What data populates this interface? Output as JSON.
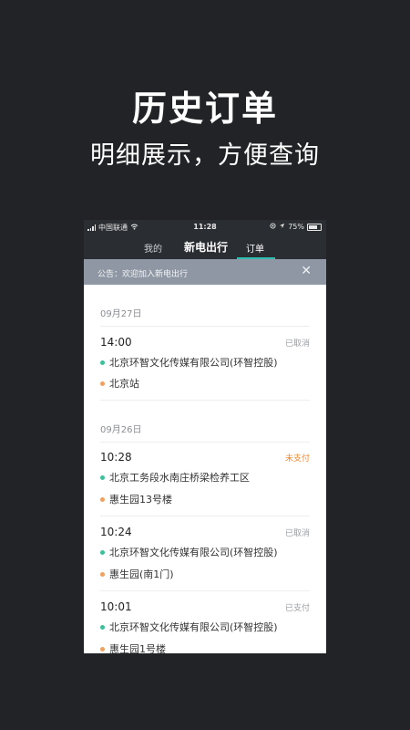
{
  "promo": {
    "headline": "历史订单",
    "subline": "明细展示，方便查询"
  },
  "status_bar": {
    "carrier": "中国联通",
    "time": "11:28",
    "battery": "75%",
    "battery_level": 0.75
  },
  "nav": {
    "tab_left": "我的",
    "title": "新电出行",
    "tab_right": "订单"
  },
  "notice": {
    "text": "公告：欢迎加入新电出行",
    "close_glyph": "✕"
  },
  "colors": {
    "accent": "#30c0b0",
    "origin_dot": "#3cc09a",
    "dest_dot": "#f0a060",
    "status_cancel": "#9a9ea3",
    "status_unpaid": "#f08a30",
    "status_paid": "#9a9ea3"
  },
  "groups": [
    {
      "date": "09月27日",
      "orders": [
        {
          "time": "14:00",
          "status": "已取消",
          "status_kind": "cancel",
          "from": "北京环智文化传媒有限公司(环智控股)",
          "to": "北京站"
        }
      ]
    },
    {
      "date": "09月26日",
      "orders": [
        {
          "time": "10:28",
          "status": "未支付",
          "status_kind": "unpaid",
          "from": "北京工务段水南庄桥梁检养工区",
          "to": "惠生园13号楼"
        },
        {
          "time": "10:24",
          "status": "已取消",
          "status_kind": "cancel",
          "from": "北京环智文化传媒有限公司(环智控股)",
          "to": "惠生园(南1门)"
        },
        {
          "time": "10:01",
          "status": "已支付",
          "status_kind": "paid",
          "from": "北京环智文化传媒有限公司(环智控股)",
          "to": "惠生园1号楼"
        }
      ]
    }
  ]
}
